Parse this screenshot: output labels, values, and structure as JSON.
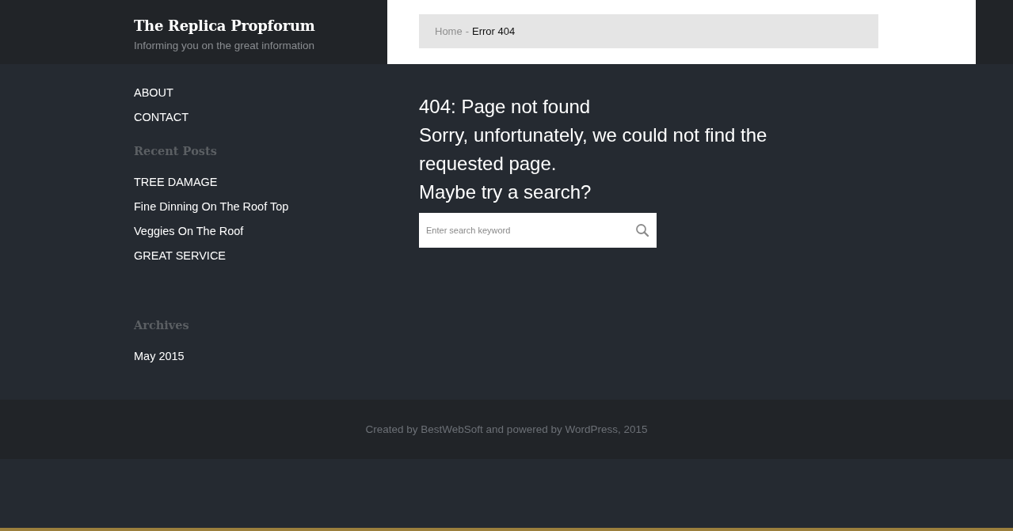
{
  "site": {
    "title": "The Replica Propforum",
    "tagline": "Informing you on the great information"
  },
  "breadcrumb": [
    {
      "label": "Home",
      "kind": "link"
    },
    {
      "label": "-",
      "kind": "separator"
    },
    {
      "label": "Error 404",
      "kind": "current"
    }
  ],
  "nav": [
    "ABOUT",
    "CONTACT"
  ],
  "recent_posts": {
    "heading": "Recent Posts",
    "items": [
      "TREE DAMAGE",
      "Fine Dinning On The Roof Top",
      "Veggies On The Roof",
      "GREAT SERVICE"
    ]
  },
  "archives": {
    "heading": "Archives",
    "items": [
      "May 2015"
    ]
  },
  "content": {
    "title": "404: Page not found",
    "message": "Sorry, unfortunately, we could not find the requested page.",
    "prompt": "Maybe try a search?"
  },
  "search": {
    "placeholder": "Enter search keyword"
  },
  "footer": "Created by BestWebSoft and powered by WordPress, 2015"
}
